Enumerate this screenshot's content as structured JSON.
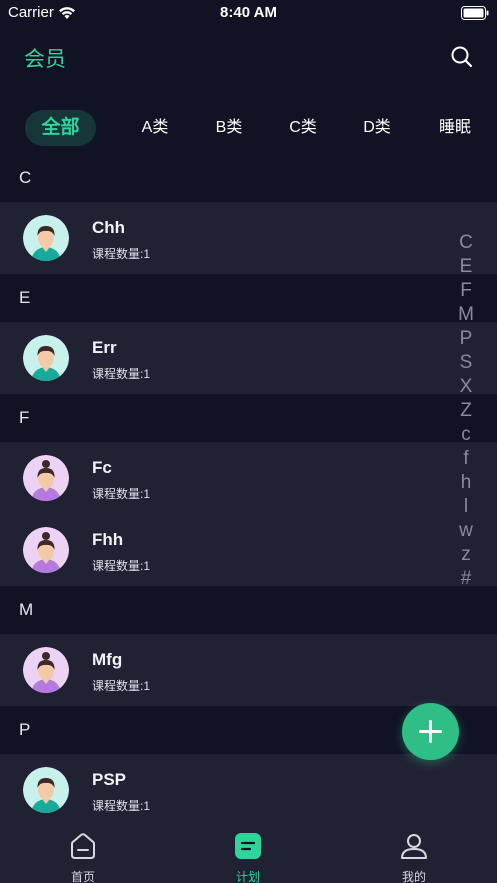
{
  "status_bar": {
    "carrier": "Carrier",
    "time": "8:40 AM"
  },
  "header": {
    "title": "会员",
    "search_icon": "search-icon"
  },
  "tabs": [
    {
      "label": "全部",
      "active": true
    },
    {
      "label": "A类",
      "active": false
    },
    {
      "label": "B类",
      "active": false
    },
    {
      "label": "C类",
      "active": false
    },
    {
      "label": "D类",
      "active": false
    },
    {
      "label": "睡眠",
      "active": false
    }
  ],
  "sections": [
    {
      "letter": "C",
      "members": [
        {
          "name": "Chh",
          "sub": "课程数量:1",
          "avatar": "male"
        }
      ]
    },
    {
      "letter": "E",
      "members": [
        {
          "name": "Err",
          "sub": "课程数量:1",
          "avatar": "male"
        }
      ]
    },
    {
      "letter": "F",
      "members": [
        {
          "name": "Fc",
          "sub": "课程数量:1",
          "avatar": "female"
        },
        {
          "name": "Fhh",
          "sub": "课程数量:1",
          "avatar": "female"
        }
      ]
    },
    {
      "letter": "M",
      "members": [
        {
          "name": "Mfg",
          "sub": "课程数量:1",
          "avatar": "female"
        }
      ]
    },
    {
      "letter": "P",
      "members": [
        {
          "name": "PSP",
          "sub": "课程数量:1",
          "avatar": "male"
        }
      ]
    }
  ],
  "index_letters": [
    "C",
    "E",
    "F",
    "M",
    "P",
    "S",
    "X",
    "Z",
    "c",
    "f",
    "h",
    "l",
    "w",
    "z",
    "#"
  ],
  "tabbar": [
    {
      "label": "首页",
      "icon": "home-icon",
      "active": false
    },
    {
      "label": "计划",
      "icon": "plan-icon",
      "active": true
    },
    {
      "label": "我的",
      "icon": "profile-icon",
      "active": false
    }
  ],
  "colors": {
    "accent": "#2fd49a",
    "background": "#121225",
    "row_background": "#212134"
  }
}
